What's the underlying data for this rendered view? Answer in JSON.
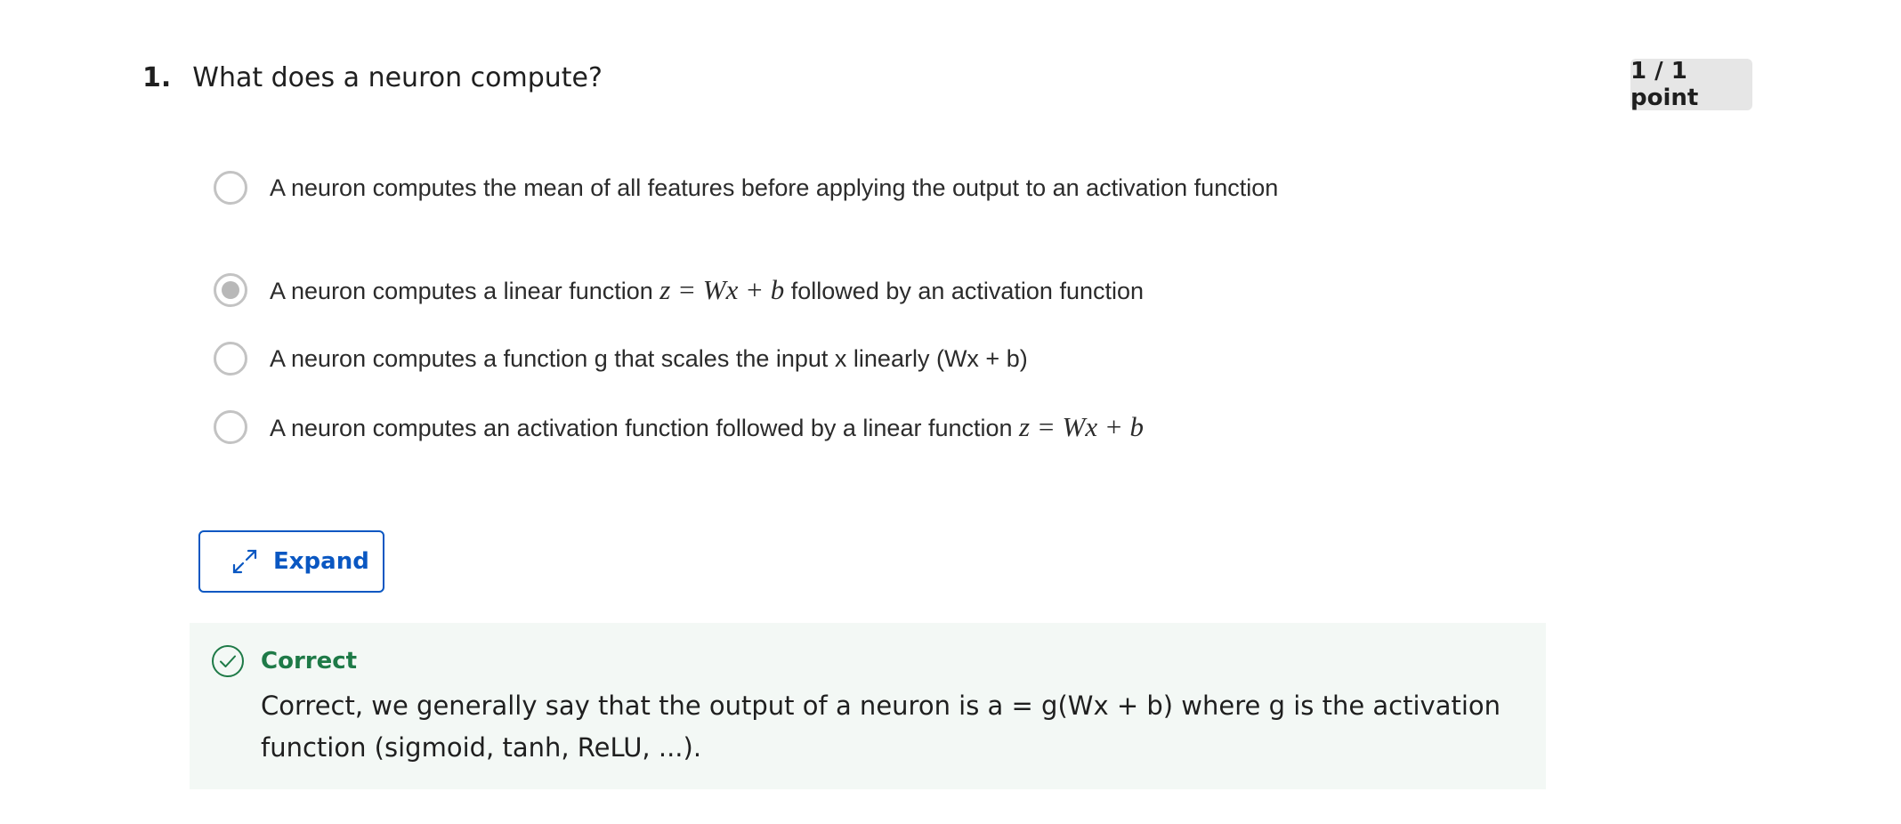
{
  "question": {
    "number": "1.",
    "text": "What does a neuron compute?",
    "points": "1 / 1 point"
  },
  "options": [
    {
      "label": "A neuron computes the mean of all features before applying the output to an activation function",
      "selected": false
    },
    {
      "label_before": "A neuron computes a linear function ",
      "math": "z = Wx + b",
      "label_after": " followed by an activation function",
      "selected": true
    },
    {
      "label": "A neuron computes a function g that scales the input x linearly (Wx + b)",
      "selected": false
    },
    {
      "label_before": "A neuron computes an activation function followed by a linear function ",
      "math": "z = Wx + b",
      "selected": false
    }
  ],
  "expand_button": {
    "label": "Expand",
    "icon": "expand-arrows-icon"
  },
  "feedback": {
    "icon": "check-circle-icon",
    "title": "Correct",
    "text": "Correct, we generally say that the output of a neuron is a = g(Wx + b) where g is the activation function (sigmoid, tanh, ReLU, ...)."
  },
  "colors": {
    "accent_blue": "#0a57c2",
    "correct_green": "#1e7a47",
    "feedback_bg": "#f3f8f5",
    "badge_bg": "#e6e6e6",
    "radio_border": "#c3c3c3"
  }
}
